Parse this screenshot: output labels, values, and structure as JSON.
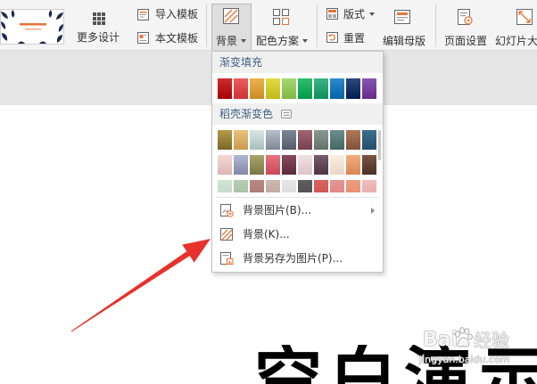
{
  "ribbon": {
    "more_design": "更多设计",
    "import_template": "导入模板",
    "this_template": "本文模板",
    "background": "背景",
    "color_scheme": "配色方案",
    "layout": "版式",
    "reset": "重置",
    "edit_master": "编辑母版",
    "page_setup": "页面设置",
    "slide_size": "幻灯片大"
  },
  "background_menu": {
    "gradient_fill": {
      "title": "渐变填充",
      "swatches": [
        "#c00000",
        "#e8383d",
        "#e7a02b",
        "#dcd21a",
        "#92d050",
        "#00b050",
        "#10a36a",
        "#0070c0",
        "#002060",
        "#7030a0"
      ]
    },
    "docer_gradients": {
      "title": "稻壳渐变色",
      "rows": [
        [
          [
            "#b59a48",
            "#7b6528"
          ],
          [
            "#e8c27a",
            "#c99a50"
          ],
          [
            "#d8e6e4",
            "#a9bebd"
          ],
          [
            "#b6bec8",
            "#7e8794"
          ],
          [
            "#7d8794",
            "#545c69"
          ],
          [
            "#a26675",
            "#74414f"
          ],
          [
            "#8b9a92",
            "#62716a"
          ],
          [
            "#6c8e8c",
            "#466664"
          ],
          [
            "#b07a5a",
            "#82503a"
          ],
          [
            "#3e6e8e",
            "#234e6a"
          ]
        ],
        [
          [
            "#f3d9d6",
            "#dcb5b1"
          ],
          [
            "#b2b8d2",
            "#8088a6"
          ],
          [
            "#a8a56c",
            "#7a7746"
          ],
          [
            "#e7727e",
            "#c94a58"
          ],
          [
            "#8a4a5c",
            "#5c2a3a"
          ],
          [
            "#f2e0e4",
            "#dbc3ca"
          ],
          [
            "#7a5c6c",
            "#4e3442"
          ],
          [
            "#fbefe2",
            "#e8d6c4"
          ],
          [
            "#f2ad7c",
            "#dc8552"
          ],
          [
            "#7a5644",
            "#4a3022"
          ]
        ],
        [
          [
            "#d3e3d3",
            "#c2d4c2"
          ],
          [
            "#b7cdb4",
            "#a2bb9e"
          ],
          [
            "#b98883",
            "#a87570"
          ],
          [
            "#cdb8b1",
            "#bba59d"
          ],
          [
            "#e6e6e6",
            "#d8d8d8"
          ],
          [
            "#5e5e5e",
            "#4c4c4c"
          ],
          [
            "#da6262",
            "#cc5050"
          ],
          [
            "#e89494",
            "#dd8080"
          ],
          [
            "#ee9d80",
            "#e48a6a"
          ],
          [
            "#f0bcbc",
            "#e6a8a8"
          ]
        ]
      ]
    },
    "items": [
      {
        "label": "背景图片(B)...",
        "icon": "background-image-icon",
        "submenu": true
      },
      {
        "label": "背景(K)...",
        "icon": "background-fill-icon",
        "submenu": false
      },
      {
        "label": "背景另存为图片(P)...",
        "icon": "save-background-image-icon",
        "submenu": false
      }
    ]
  },
  "slide": {
    "title": "空白演示"
  },
  "watermark": {
    "brand": "Bai",
    "product": "经验",
    "site": "jingyan.baidu.com"
  },
  "colors": {
    "annotation_arrow": "#e8312a",
    "accent_orange": "#e8743b",
    "ribbon_background": "#f4f4f4"
  }
}
